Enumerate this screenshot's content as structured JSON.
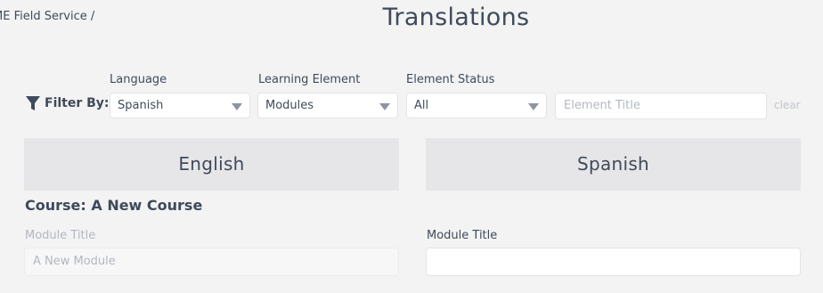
{
  "header": {
    "breadcrumb": "ME Field Service /",
    "title": "Translations"
  },
  "filters": {
    "filter_by_label": "Filter By:",
    "language": {
      "label": "Language",
      "value": "Spanish"
    },
    "learning_element": {
      "label": "Learning Element",
      "value": "Modules"
    },
    "element_status": {
      "label": "Element Status",
      "value": "All"
    },
    "element_title": {
      "placeholder": "Element Title",
      "value": ""
    },
    "clear_label": "clear"
  },
  "columns": {
    "source_language": "English",
    "target_language": "Spanish"
  },
  "course": {
    "title": "Course: A New Course"
  },
  "module": {
    "source_label": "Module Title",
    "source_value": "A New Module",
    "target_label": "Module Title",
    "target_value": ""
  },
  "colors": {
    "background": "#f3f3f4",
    "text": "#3f4a5a",
    "header_bar": "#e6e6e8"
  },
  "icons": {
    "filter": "filter-funnel-icon",
    "dropdown": "caret-down-icon"
  }
}
